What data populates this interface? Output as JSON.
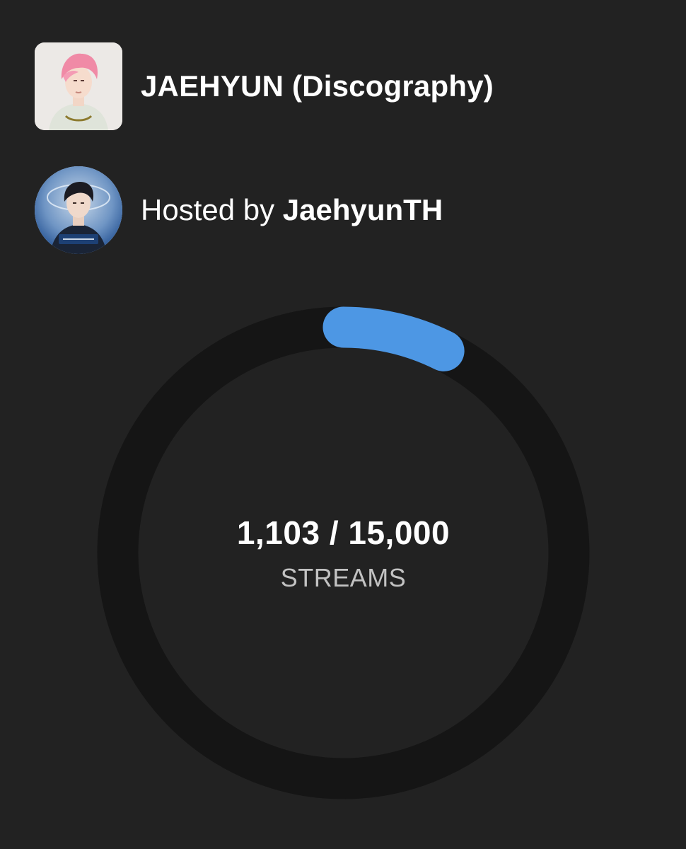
{
  "playlist": {
    "title": "JAEHYUN (Discography)",
    "cover_image": "artist-pink-hair-photo"
  },
  "host": {
    "prefix": "Hosted by ",
    "name": "JaehyunTH",
    "avatar_image": "host-avatar-photo"
  },
  "progress": {
    "count_text": "1,103 / 15,000",
    "unit_label": "STREAMS",
    "current": 1103,
    "goal": 15000,
    "fraction": 0.0735
  },
  "colors": {
    "background": "#222222",
    "ring_track": "#151515",
    "ring_progress": "#4d97e4",
    "text_primary": "#ffffff",
    "text_secondary": "#c2c2c2"
  }
}
